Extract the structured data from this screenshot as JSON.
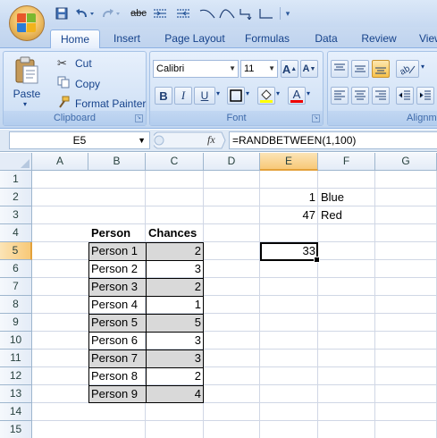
{
  "qat": {
    "icons": [
      "save-icon",
      "undo-icon",
      "redo-icon",
      "strikethrough-icon",
      "merge-icon",
      "unmerge-icon",
      "connector-icon",
      "connector-icon",
      "connector-icon",
      "connector-icon",
      "qat-dropdown-icon"
    ],
    "strikethrough_text": "abc"
  },
  "tabs": [
    "Home",
    "Insert",
    "Page Layout",
    "Formulas",
    "Data",
    "Review",
    "View"
  ],
  "active_tab": "Home",
  "clipboard": {
    "paste": "Paste",
    "cut": "Cut",
    "copy": "Copy",
    "format_painter": "Format Painter",
    "label": "Clipboard"
  },
  "font": {
    "font_name": "Calibri",
    "font_size": "11",
    "grow_glyph": "A",
    "shrink_glyph": "A",
    "bold": "B",
    "italic": "I",
    "underline": "U",
    "font_color_glyph": "A",
    "label": "Font"
  },
  "alignment": {
    "label": "Alignm"
  },
  "formula_bar": {
    "name_box": "E5",
    "fx": "fx",
    "formula": "=RANDBETWEEN(1,100)"
  },
  "grid": {
    "columns": [
      "A",
      "B",
      "C",
      "D",
      "E",
      "F",
      "G"
    ],
    "selected_column": "E",
    "rows": [
      "1",
      "2",
      "3",
      "4",
      "5",
      "6",
      "7",
      "8",
      "9",
      "10",
      "11",
      "12",
      "13",
      "14",
      "15"
    ],
    "selected_row": "5",
    "e2": "1",
    "f2": "Blue",
    "e3": "47",
    "f3": "Red",
    "header_person": "Person",
    "header_chances": "Chances",
    "e5": "33",
    "people": [
      {
        "name": "Person 1",
        "chances": "2"
      },
      {
        "name": "Person 2",
        "chances": "3"
      },
      {
        "name": "Person 3",
        "chances": "2"
      },
      {
        "name": "Person 4",
        "chances": "1"
      },
      {
        "name": "Person 5",
        "chances": "5"
      },
      {
        "name": "Person 6",
        "chances": "3"
      },
      {
        "name": "Person 7",
        "chances": "3"
      },
      {
        "name": "Person 8",
        "chances": "2"
      },
      {
        "name": "Person 9",
        "chances": "4"
      }
    ]
  },
  "colors": {
    "ribbon": "#c8dbf2",
    "selection_header": "#f8c978",
    "shaded_cell": "#d9d9d9"
  }
}
